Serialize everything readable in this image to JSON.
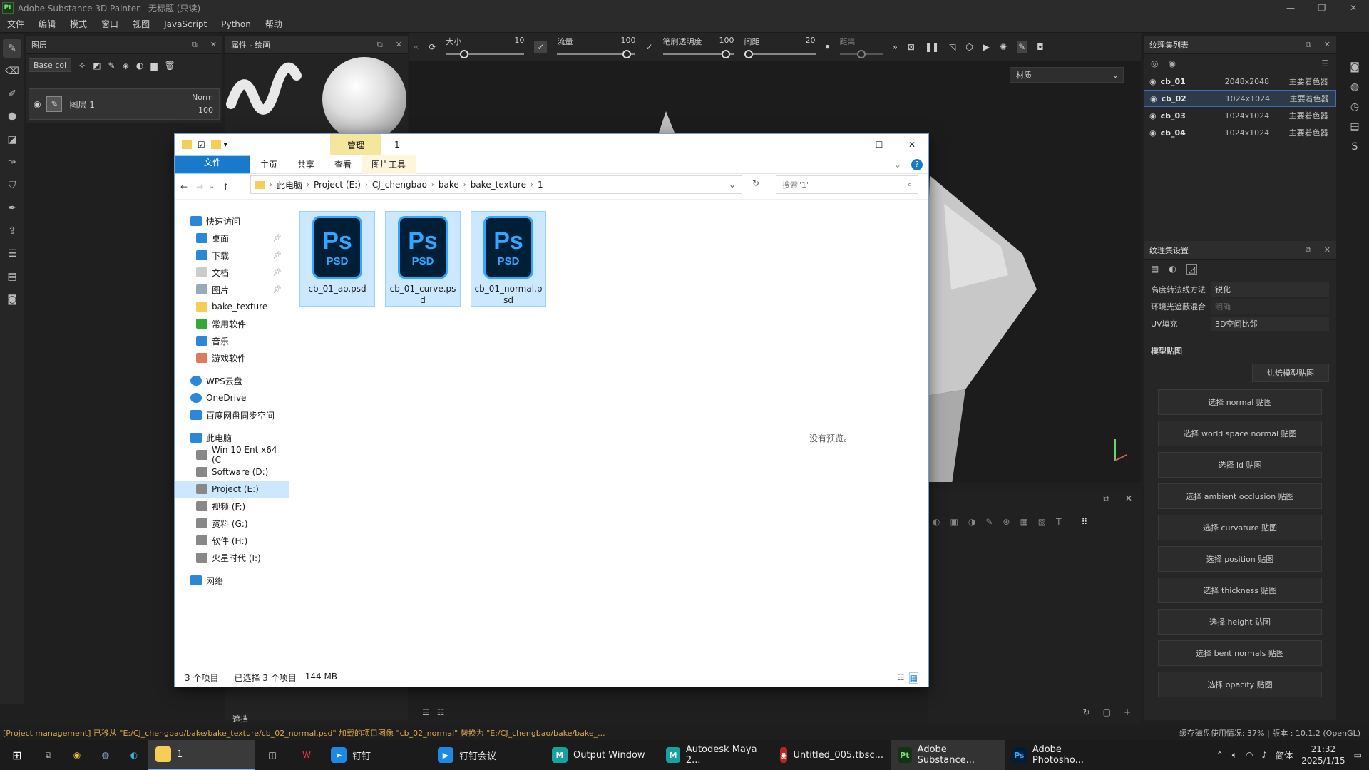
{
  "app": {
    "title": "Adobe Substance 3D Painter - 无标题 (只读)",
    "logo": "Pt"
  },
  "menu": [
    "文件",
    "编辑",
    "模式",
    "窗口",
    "视图",
    "JavaScript",
    "Python",
    "帮助"
  ],
  "layers_panel": {
    "title": "图层",
    "channel": "Base col",
    "layer_name": "图层 1",
    "blend": "Norm",
    "opacity": "100"
  },
  "props_panel": {
    "title": "属性 - 绘画"
  },
  "paintbar": {
    "size_label": "大小",
    "size_value": "10",
    "flow_label": "流量",
    "flow_value": "100",
    "opacity_label": "笔刷透明度",
    "opacity_value": "100",
    "spacing_label": "间距",
    "spacing_value": "20",
    "distance_label": "距离"
  },
  "viewport": {
    "mode": "材质",
    "no_preview": "没有预览。"
  },
  "texture_list": {
    "title": "纹理集列表",
    "items": [
      {
        "name": "cb_01",
        "size": "2048x2048",
        "shader": "主要着色器"
      },
      {
        "name": "cb_02",
        "size": "1024x1024",
        "shader": "主要着色器"
      },
      {
        "name": "cb_03",
        "size": "1024x1024",
        "shader": "主要着色器"
      },
      {
        "name": "cb_04",
        "size": "1024x1024",
        "shader": "主要着色器"
      }
    ]
  },
  "texture_settings": {
    "title": "纹理集设置",
    "rows": [
      {
        "label": "高度转法线方法",
        "value": "锐化"
      },
      {
        "label": "环境光遮蔽混合",
        "value": "明确"
      },
      {
        "label": "UV填充",
        "value": "3D空间比邻"
      }
    ],
    "section": "模型贴图",
    "bake_btn": "烘焙模型贴图",
    "map_buttons": [
      "选择 normal 贴图",
      "选择 world space normal 贴图",
      "选择 id 贴图",
      "选择 ambient occlusion 贴图",
      "选择 curvature 贴图",
      "选择 position 贴图",
      "选择 thickness 贴图",
      "选择 height 贴图",
      "选择 bent normals 贴图",
      "选择 opacity 贴图"
    ]
  },
  "explorer": {
    "window_title": "1",
    "manage_tab": "管理",
    "ribbon": {
      "file": "文件",
      "home": "主页",
      "share": "共享",
      "view": "查看",
      "picture_tools": "图片工具"
    },
    "breadcrumb": [
      "此电脑",
      "Project (E:)",
      "CJ_chengbao",
      "bake",
      "bake_texture",
      "1"
    ],
    "search_placeholder": "搜索\"1\"",
    "nav": [
      {
        "label": "快速访问",
        "icon": "star-icon"
      },
      {
        "label": "桌面",
        "icon": "desktop-icon",
        "pin": true
      },
      {
        "label": "下载",
        "icon": "download-icon",
        "pin": true
      },
      {
        "label": "文档",
        "icon": "document-icon",
        "pin": true
      },
      {
        "label": "图片",
        "icon": "picture-icon",
        "pin": true
      },
      {
        "label": "bake_texture",
        "icon": "folder-icon"
      },
      {
        "label": "常用软件",
        "icon": "tree-icon"
      },
      {
        "label": "音乐",
        "icon": "music-icon"
      },
      {
        "label": "游戏软件",
        "icon": "game-icon"
      },
      {
        "label": "WPS云盘",
        "icon": "cloud-icon"
      },
      {
        "label": "OneDrive",
        "icon": "cloud-icon"
      },
      {
        "label": "百度网盘同步空间",
        "icon": "baidu-icon"
      },
      {
        "label": "此电脑",
        "icon": "computer-icon"
      },
      {
        "label": "Win 10 Ent x64 (C",
        "icon": "drive-icon"
      },
      {
        "label": "Software (D:)",
        "icon": "drive-icon"
      },
      {
        "label": "Project (E:)",
        "icon": "drive-icon"
      },
      {
        "label": "视频 (F:)",
        "icon": "drive-icon"
      },
      {
        "label": "资料 (G:)",
        "icon": "drive-icon"
      },
      {
        "label": "软件 (H:)",
        "icon": "drive-icon"
      },
      {
        "label": "火星时代 (I:)",
        "icon": "drive-icon"
      },
      {
        "label": "网络",
        "icon": "network-icon"
      }
    ],
    "files": [
      {
        "name": "cb_01_ao.psd",
        "type": "PSD"
      },
      {
        "name": "cb_01_curve.psd",
        "type": "PSD"
      },
      {
        "name": "cb_01_normal.psd",
        "type": "PSD"
      }
    ],
    "status": {
      "count": "3 个项目",
      "selected": "已选择 3 个项目",
      "size": "144 MB"
    }
  },
  "bottom_props": {
    "label": "遮挡"
  },
  "statusbar": {
    "message": "[Project management] 已移从 \"E:/CJ_chengbao/bake/bake_texture/cb_02_normal.psd\" 加载的项目图像 \"cb_02_normal\" 替换为 \"E:/CJ_chengbao/bake/bake_...",
    "right": "缓存磁盘使用情况: 37% | 版本 : 10.1.2 (OpenGL)"
  },
  "taskbar": {
    "items": [
      {
        "label": "1",
        "icon": "folder-icon"
      },
      {
        "label": "钉钉",
        "icon": "dingtalk-icon"
      },
      {
        "label": "钉钉会议",
        "icon": "meeting-icon"
      },
      {
        "label": "Output Window",
        "icon": "maya-icon"
      },
      {
        "label": "Autodesk Maya 2...",
        "icon": "maya-icon"
      },
      {
        "label": "Untitled_005.tbsc...",
        "icon": "app-icon"
      },
      {
        "label": "Adobe Substance...",
        "icon": "substance-icon"
      },
      {
        "label": "Adobe Photosho...",
        "icon": "photoshop-icon"
      }
    ],
    "ime": "简体",
    "time": "21:32",
    "date": "2025/1/15"
  }
}
